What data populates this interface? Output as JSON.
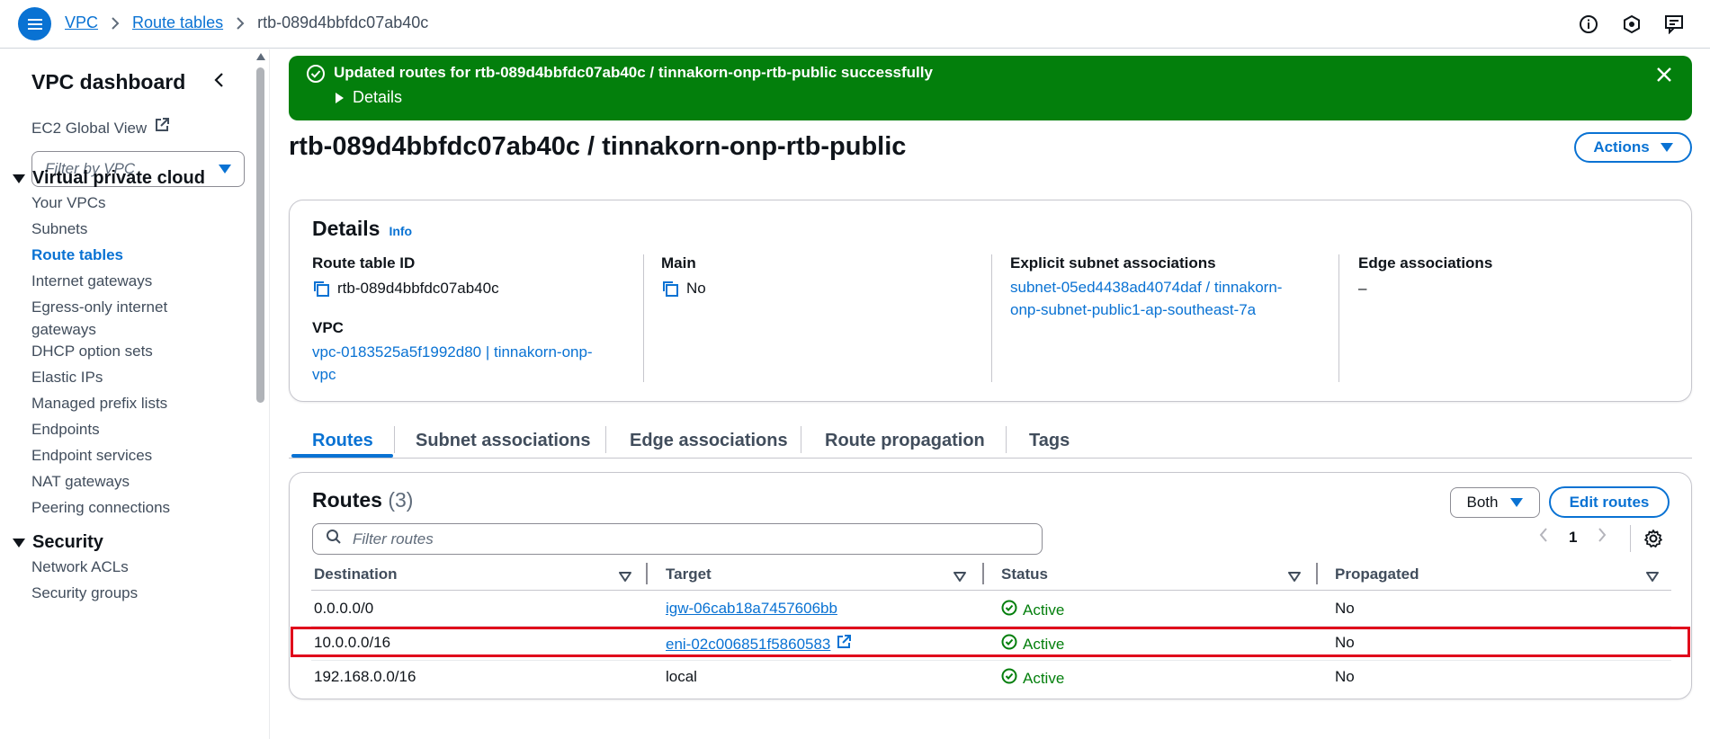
{
  "breadcrumb": {
    "items": [
      "VPC",
      "Route tables"
    ],
    "current": "rtb-089d4bbfdc07ab40c"
  },
  "sidebar": {
    "title": "VPC dashboard",
    "global_view": "EC2 Global View",
    "filter_placeholder": "Filter by VPC",
    "section_vpc": "Virtual private cloud",
    "vpc_items": [
      "Your VPCs",
      "Subnets",
      "Route tables",
      "Internet gateways",
      "Egress-only internet gateways",
      "DHCP option sets",
      "Elastic IPs",
      "Managed prefix lists",
      "Endpoints",
      "Endpoint services",
      "NAT gateways",
      "Peering connections"
    ],
    "active_item": "Route tables",
    "section_security": "Security",
    "security_items": [
      "Network ACLs",
      "Security groups"
    ]
  },
  "flash": {
    "message": "Updated routes for rtb-089d4bbfdc07ab40c / tinnakorn-onp-rtb-public successfully",
    "details_label": "Details"
  },
  "page": {
    "title": "rtb-089d4bbfdc07ab40c / tinnakorn-onp-rtb-public",
    "actions_label": "Actions"
  },
  "details": {
    "title": "Details",
    "info": "Info",
    "route_table_id_label": "Route table ID",
    "route_table_id": "rtb-089d4bbfdc07ab40c",
    "vpc_label": "VPC",
    "vpc_line1": "vpc-0183525a5f1992d80 | tinnakorn-onp-",
    "vpc_line2": "vpc",
    "main_label": "Main",
    "main_value": "No",
    "explicit_label": "Explicit subnet associations",
    "explicit_line1": "subnet-05ed4438ad4074daf / tinnakorn-",
    "explicit_line2": "onp-subnet-public1-ap-southeast-7a",
    "edge_label": "Edge associations",
    "edge_value": "–"
  },
  "tabs": [
    "Routes",
    "Subnet associations",
    "Edge associations",
    "Route propagation",
    "Tags"
  ],
  "routes": {
    "title": "Routes",
    "count": "(3)",
    "select_value": "Both",
    "edit_label": "Edit routes",
    "filter_placeholder": "Filter routes",
    "page": "1",
    "columns": [
      "Destination",
      "Target",
      "Status",
      "Propagated"
    ],
    "rows": [
      {
        "destination": "0.0.0.0/0",
        "target": "igw-06cab18a7457606bb",
        "status": "Active",
        "propagated": "No"
      },
      {
        "destination": "10.0.0.0/16",
        "target": "eni-02c006851f5860583",
        "status": "Active",
        "propagated": "No"
      },
      {
        "destination": "192.168.0.0/16",
        "target": "local",
        "status": "Active",
        "propagated": "No"
      }
    ]
  },
  "colors": {
    "accent": "#0972d3",
    "success": "#037f0c",
    "highlight": "#e0001b"
  }
}
